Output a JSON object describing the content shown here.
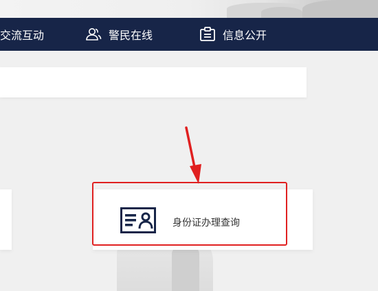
{
  "navbar": {
    "items": [
      {
        "label": "交流互动",
        "icon": "chat-icon"
      },
      {
        "label": "警民在线",
        "icon": "users-icon"
      },
      {
        "label": "信息公开",
        "icon": "clipboard-icon"
      }
    ]
  },
  "search": {
    "value": ""
  },
  "services": {
    "featured": {
      "label": "身份证办理查询",
      "icon": "id-card-icon"
    }
  },
  "annotation": {
    "color": "#e02020"
  },
  "colors": {
    "navbar_bg": "#172548",
    "card_icon": "#172548",
    "highlight": "#e02020"
  }
}
